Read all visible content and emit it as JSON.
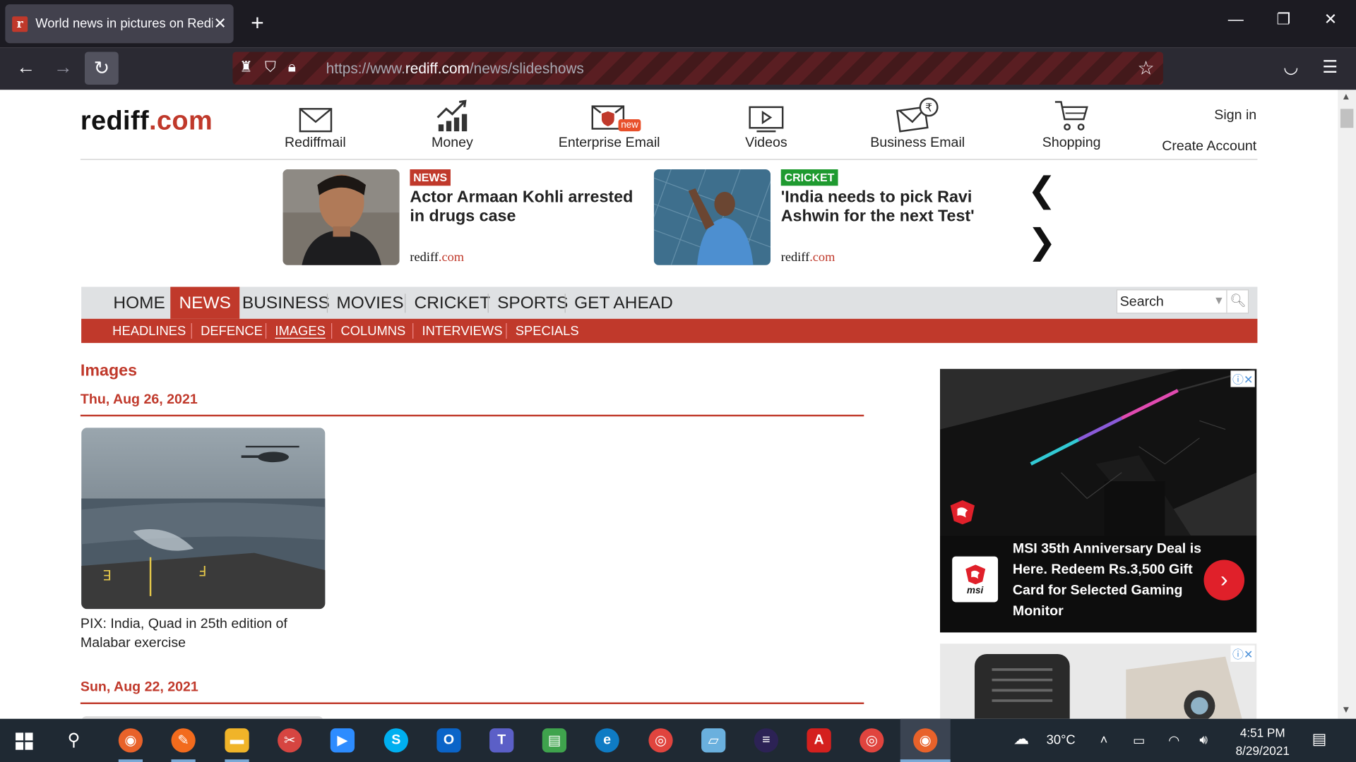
{
  "browser": {
    "tab_title": "World news in pictures on Rediff",
    "favicon_letter": "r",
    "url_prefix": "https://www.",
    "url_domain": "rediff.com",
    "url_path": "/news/slideshows"
  },
  "header": {
    "logo_main": "rediff",
    "logo_suffix": ".com",
    "nav": [
      {
        "label": "Rediffmail",
        "icon": "mail-icon"
      },
      {
        "label": "Money",
        "icon": "chart-icon"
      },
      {
        "label": "Enterprise Email",
        "icon": "shield-mail-icon",
        "badge": "new"
      },
      {
        "label": "Videos",
        "icon": "video-icon"
      },
      {
        "label": "Business Email",
        "icon": "rupee-mail-icon"
      },
      {
        "label": "Shopping",
        "icon": "cart-icon"
      }
    ],
    "sign_in": "Sign in",
    "create_account": "Create Account"
  },
  "stories": [
    {
      "badge": "NEWS",
      "badge_color": "#c0392b",
      "headline": "Actor Armaan Kohli arrested in drugs case",
      "source_main": "rediff",
      "source_suffix": ".com"
    },
    {
      "badge": "CRICKET",
      "badge_color": "#1e9a2f",
      "headline": "'India needs to pick Ravi Ashwin for the next Test'",
      "source_main": "rediff",
      "source_suffix": ".com"
    }
  ],
  "main_nav": [
    "HOME",
    "NEWS",
    "BUSINESS",
    "MOVIES",
    "CRICKET",
    "SPORTS",
    "GET AHEAD"
  ],
  "main_nav_active": "NEWS",
  "search": {
    "placeholder": "Search"
  },
  "sub_nav": [
    "HEADLINES",
    "DEFENCE",
    "IMAGES",
    "COLUMNS",
    "INTERVIEWS",
    "SPECIALS"
  ],
  "sub_nav_active": "IMAGES",
  "content": {
    "section_title": "Images",
    "dates": [
      "Thu, Aug 26, 2021",
      "Sun, Aug 22, 2021"
    ],
    "card_caption": "PIX: India, Quad in 25th edition of Malabar exercise"
  },
  "ad": {
    "text": "MSI 35th Anniversary Deal is Here. Redeem Rs.3,500 Gift Card for Selected Gaming Monitor",
    "brand": "msi",
    "info_close": "ⓘ✕"
  },
  "taskbar": {
    "weather": "30°C",
    "time": "4:51 PM",
    "date": "8/29/2021"
  },
  "colors": {
    "brand_red": "#c0392b",
    "nav_gray": "#dfe1e3",
    "taskbar": "#1f2933"
  }
}
